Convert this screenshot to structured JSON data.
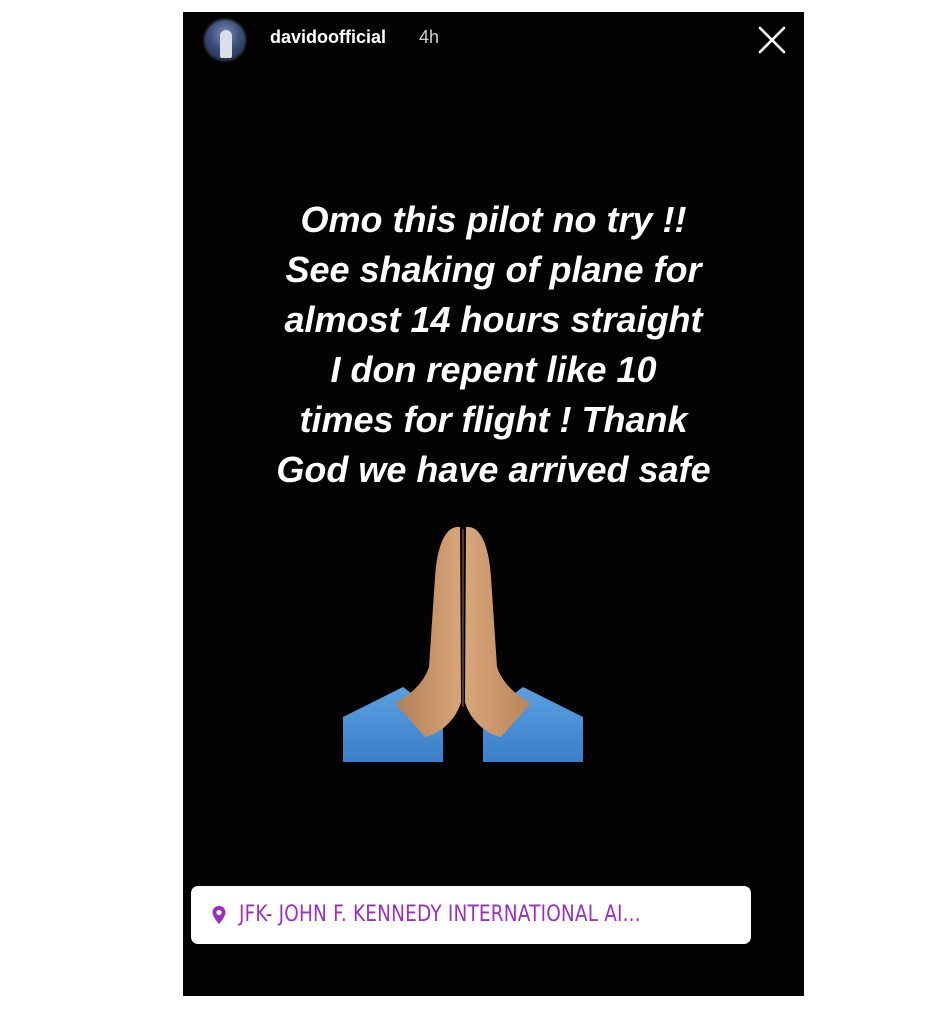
{
  "story": {
    "username": "davidoofficial",
    "timestamp": "4h",
    "close_icon": "close-icon",
    "message_lines": [
      "Omo this pilot no try !!",
      "See shaking of plane for",
      "almost 14 hours straight",
      "I don repent like 10",
      "times for flight ! Thank",
      "God we have arrived safe"
    ],
    "emoji": "folded-hands-emoji",
    "location": {
      "icon": "location-pin-icon",
      "label": "JFK-  JOHN F. KENNEDY INTERNATIONAL AI..."
    }
  },
  "colors": {
    "background": "#030303",
    "text": "#ffffff",
    "location_text": "#9b2fbf",
    "sticker_bg": "#ffffff"
  }
}
